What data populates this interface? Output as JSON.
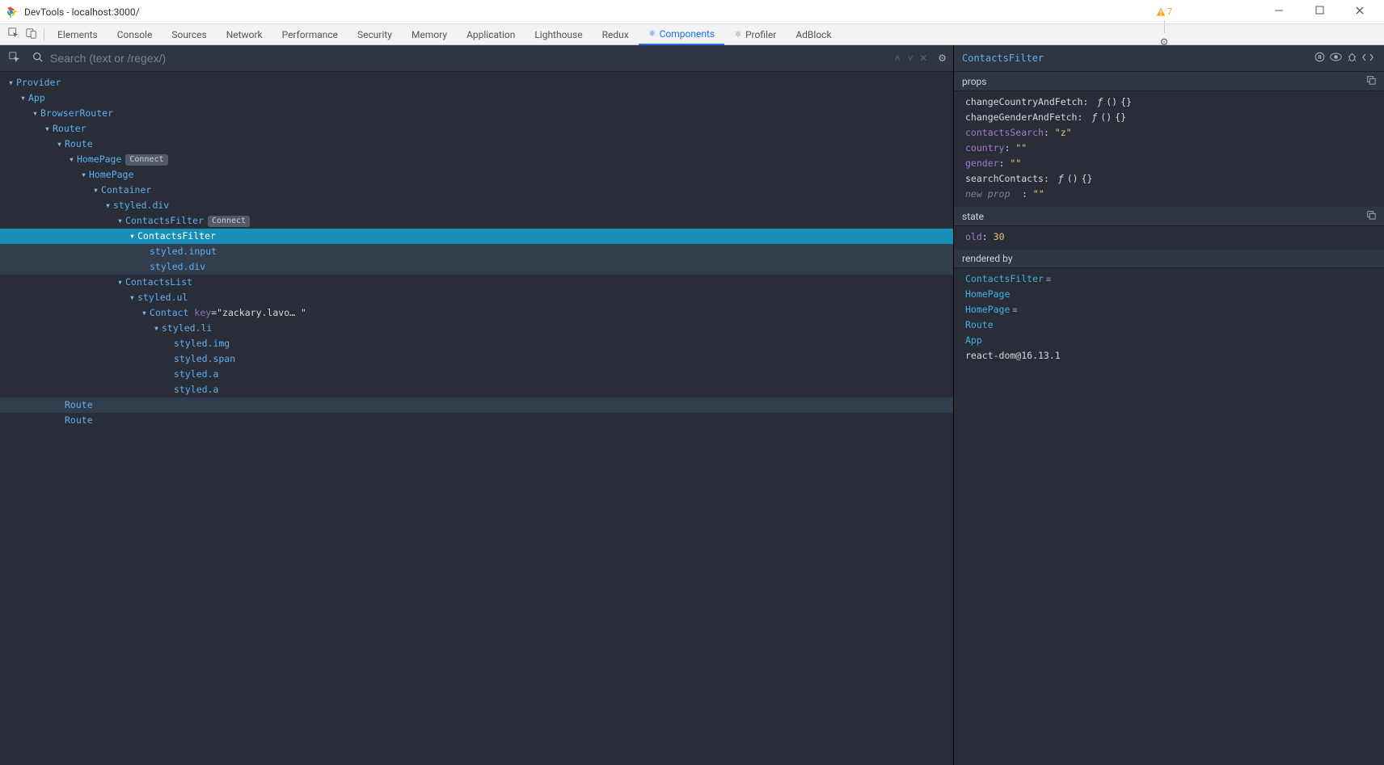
{
  "window": {
    "title": "DevTools - localhost:3000/"
  },
  "tabs": {
    "items": [
      "Elements",
      "Console",
      "Sources",
      "Network",
      "Performance",
      "Security",
      "Memory",
      "Application",
      "Lighthouse",
      "Redux",
      "Components",
      "Profiler",
      "AdBlock"
    ],
    "active_index": 10,
    "react_tabs": [
      10,
      11
    ],
    "warning_count": "7"
  },
  "search": {
    "placeholder": "Search (text or /regex/)"
  },
  "tree": [
    {
      "depth": 0,
      "label": "Provider",
      "expandable": true
    },
    {
      "depth": 1,
      "label": "App",
      "expandable": true
    },
    {
      "depth": 2,
      "label": "BrowserRouter",
      "expandable": true
    },
    {
      "depth": 3,
      "label": "Router",
      "expandable": true
    },
    {
      "depth": 4,
      "label": "Route",
      "expandable": true
    },
    {
      "depth": 5,
      "label": "HomePage",
      "expandable": true,
      "badge": "Connect"
    },
    {
      "depth": 6,
      "label": "HomePage",
      "expandable": true
    },
    {
      "depth": 7,
      "label": "Container",
      "expandable": true
    },
    {
      "depth": 8,
      "label": "styled.div",
      "expandable": true
    },
    {
      "depth": 9,
      "label": "ContactsFilter",
      "expandable": true,
      "badge": "Connect"
    },
    {
      "depth": 10,
      "label": "ContactsFilter",
      "expandable": true,
      "selected": true
    },
    {
      "depth": 11,
      "label": "styled.input",
      "expandable": false,
      "highlight": true
    },
    {
      "depth": 11,
      "label": "styled.div",
      "expandable": false,
      "highlight": true
    },
    {
      "depth": 9,
      "label": "ContactsList",
      "expandable": true
    },
    {
      "depth": 10,
      "label": "styled.ul",
      "expandable": true
    },
    {
      "depth": 11,
      "label": "Contact",
      "expandable": true,
      "key": "\"zackary.lavo… \""
    },
    {
      "depth": 12,
      "label": "styled.li",
      "expandable": true
    },
    {
      "depth": 13,
      "label": "styled.img",
      "expandable": false
    },
    {
      "depth": 13,
      "label": "styled.span",
      "expandable": false
    },
    {
      "depth": 13,
      "label": "styled.a",
      "expandable": false
    },
    {
      "depth": 13,
      "label": "styled.a",
      "expandable": false
    },
    {
      "depth": 4,
      "label": "Route",
      "expandable": false,
      "highlight": true
    },
    {
      "depth": 4,
      "label": "Route",
      "expandable": false
    }
  ],
  "details": {
    "selected": "ContactsFilter",
    "props_header": "props",
    "props": [
      {
        "name": "changeCountryAndFetch",
        "type": "fn"
      },
      {
        "name": "changeGenderAndFetch",
        "type": "fn"
      },
      {
        "name": "contactsSearch",
        "type": "string",
        "value": "\"z\"",
        "dimname": true
      },
      {
        "name": "country",
        "type": "string",
        "value": "\"\"",
        "dimname": true
      },
      {
        "name": "gender",
        "type": "string",
        "value": "\"\"",
        "dimname": true
      },
      {
        "name": "searchContacts",
        "type": "fn"
      }
    ],
    "new_prop_label": "new prop",
    "new_prop_value": "\"\"",
    "state_header": "state",
    "state": [
      {
        "name": "old",
        "type": "num",
        "value": "30",
        "dimname": true
      }
    ],
    "rendered_header": "rendered by",
    "rendered_by": [
      {
        "label": "ContactsFilter",
        "link": true,
        "equal": true
      },
      {
        "label": "HomePage",
        "link": true
      },
      {
        "label": "HomePage",
        "link": true,
        "equal": true
      },
      {
        "label": "Route",
        "link": true
      },
      {
        "label": "App",
        "link": true
      },
      {
        "label": "react-dom@16.13.1",
        "link": false
      }
    ]
  }
}
